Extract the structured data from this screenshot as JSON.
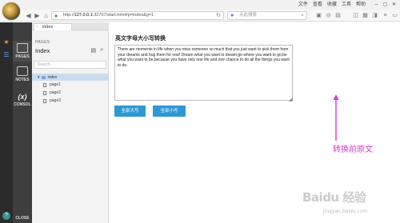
{
  "browser": {
    "url_host": "127.0.0.1",
    "url_rest": ":32767/start.html#p=index&g=1",
    "search_placeholder": "点此搜索",
    "menu": [
      "文件",
      "查看",
      "收藏",
      "工具",
      "帮助"
    ]
  },
  "app": {
    "tab_label": "index",
    "panels": {
      "pages_label": "PAGES",
      "notes_label": "NOTES",
      "console_label": "CONSOL",
      "console_icon": "(x)",
      "close_label": "CLOSE"
    },
    "pages_panel": {
      "section": "PAGES",
      "title": "Index",
      "search_placeholder": "Search",
      "root": "index",
      "children": [
        "page1",
        "page2",
        "page3"
      ]
    }
  },
  "content": {
    "heading": "英文字母大小写转换",
    "text": "There are moments in life when you miss someone so much that you just want to pick them from your dreams and hug them for real! Dream what you want to dream;go where you want to go;be what you want to be,because you have only one life and one chance to do all the things you want to do.",
    "btn_upper": "全部大写",
    "btn_lower": "全部小写",
    "annotation": "转换前原文",
    "annotation_color": "#d63cc8"
  },
  "watermark": {
    "logo": "Baidu 经验",
    "sub": "jingyan.baidu.com"
  },
  "colors": {
    "accent": "#2e98d4",
    "rail": "#2b2b2b",
    "panel": "#3e3e3e",
    "selected_row": "#c9dcef"
  },
  "icons": {
    "back": "back-arrow-icon",
    "forward": "forward-arrow-icon",
    "refresh": "refresh-icon",
    "home": "home-icon",
    "star": "star-icon",
    "pages": "pages-icon",
    "notes": "notes-icon"
  }
}
